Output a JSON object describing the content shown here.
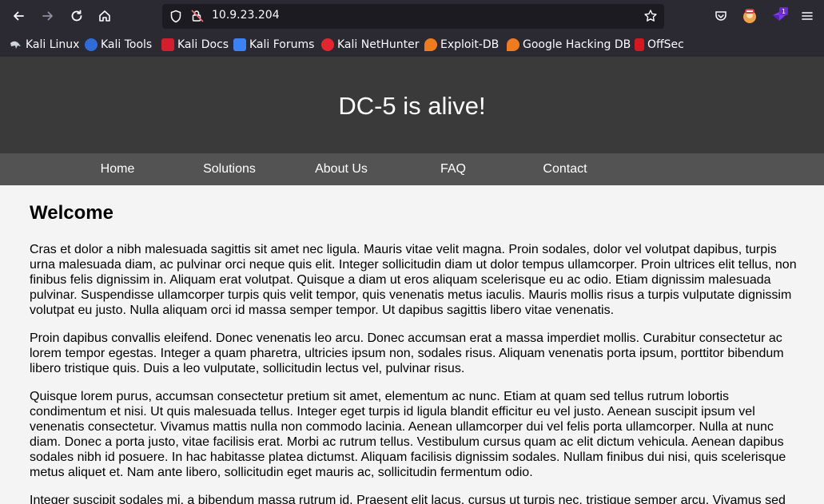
{
  "browser": {
    "url": "10.9.23.204",
    "bookmarks": [
      "Kali Linux",
      "Kali Tools",
      "Kali Docs",
      "Kali Forums",
      "Kali NetHunter",
      "Exploit-DB",
      "Google Hacking DB",
      "OffSec"
    ],
    "extension_badge": "1",
    "colors": {
      "chrome": "#2b2a33",
      "urlbar": "#1c1b22",
      "text": "#fbfbfe"
    }
  },
  "page": {
    "title": "DC-5 is alive!",
    "menu": [
      "Home",
      "Solutions",
      "About Us",
      "FAQ",
      "Contact"
    ],
    "heading": "Welcome",
    "paragraphs": [
      "Cras et dolor a nibh malesuada sagittis sit amet nec ligula. Mauris vitae velit magna. Proin sodales, dolor vel volutpat dapibus, turpis urna malesuada diam, ac pulvinar orci neque quis elit. Integer sollicitudin diam ut dolor tempus ullamcorper. Proin ultrices elit tellus, non finibus felis dignissim in. Aliquam erat volutpat. Quisque a diam ut eros aliquam scelerisque eu ac odio. Etiam dignissim malesuada pulvinar. Suspendisse ullamcorper turpis quis velit tempor, quis venenatis metus iaculis. Mauris mollis risus a turpis vulputate dignissim volutpat eu justo. Nulla aliquam orci id massa semper tempor. Ut dapibus sagittis libero vitae venenatis.",
      "Proin dapibus convallis eleifend. Donec venenatis leo arcu. Donec accumsan erat a massa imperdiet mollis. Curabitur consectetur ac lorem tempor egestas. Integer a quam pharetra, ultricies ipsum non, sodales risus. Aliquam venenatis porta ipsum, porttitor bibendum libero tristique quis. Duis a leo vulputate, sollicitudin lectus vel, pulvinar risus.",
      "Quisque lorem purus, accumsan consectetur pretium sit amet, elementum ac nunc. Etiam at quam sed tellus rutrum lobortis condimentum et nisi. Ut quis malesuada tellus. Integer eget turpis id ligula blandit efficitur eu vel justo. Aenean suscipit ipsum vel venenatis consectetur. Vivamus mattis nulla non commodo lacinia. Aenean ullamcorper dui vel felis porta ullamcorper. Nulla at nunc diam. Donec a porta justo, vitae facilisis erat. Morbi ac rutrum tellus. Vestibulum cursus quam ac elit dictum vehicula. Aenean dapibus sodales nibh id posuere. In hac habitasse platea dictumst. Aliquam facilisis dignissim sodales. Nullam finibus dui nisi, quis scelerisque metus aliquet et. Nam ante libero, sollicitudin eget mauris ac, sollicitudin fermentum odio.",
      "Integer suscipit sodales mi, a bibendum massa rutrum id. Praesent elit lacus, cursus ut turpis nec, tristique semper arcu. Vivamus sed"
    ],
    "colors": {
      "header": "#3a3a3a",
      "menu": "#535353",
      "body": "#f4f4f4"
    }
  }
}
